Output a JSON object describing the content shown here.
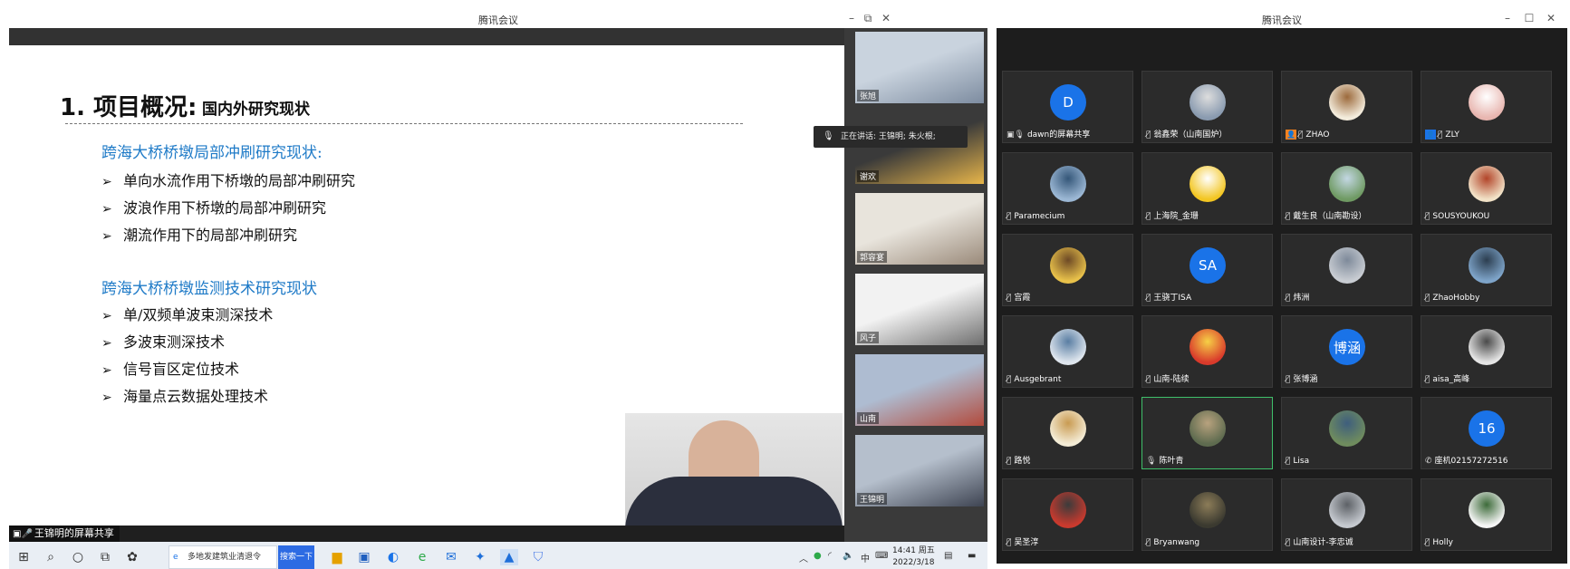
{
  "left_window": {
    "title": "腾讯会议",
    "controls": {
      "minimize": "–",
      "restore": "⧉",
      "close": "✕"
    },
    "slide": {
      "title": "1. 项目概况:",
      "subtitle": "国内外研究现状",
      "sections": [
        {
          "heading": "跨海大桥桥墩局部冲刷研究现状:",
          "items": [
            "单向水流作用下桥墩的局部冲刷研究",
            "波浪作用下桥墩的局部冲刷研究",
            "潮流作用下的局部冲刷研究"
          ]
        },
        {
          "heading": "跨海大桥桥墩监测技术研究现状",
          "items": [
            "单/双频单波束测深技术",
            "多波束测深技术",
            "信号盲区定位技术",
            "海量点云数据处理技术"
          ]
        }
      ],
      "bullet_glyph": "➢"
    },
    "share_label": "王锦明的屏幕共享",
    "speaking": "正在讲话: 王锦明; 朱火根;",
    "thumbnails": [
      {
        "name": "张旭",
        "colors": [
          "#c9d3de",
          "#7d8ca0"
        ]
      },
      {
        "name": "谢欢",
        "colors": [
          "#3a3a3a",
          "#e7b54a"
        ]
      },
      {
        "name": "郭容宴",
        "colors": [
          "#e8e4dc",
          "#9a8a7a"
        ]
      },
      {
        "name": "风子",
        "colors": [
          "#f2f2f2",
          "#6f6f6f"
        ]
      },
      {
        "name": "山南",
        "colors": [
          "#aebcd1",
          "#b24a3c"
        ]
      },
      {
        "name": "王锦明",
        "colors": [
          "#b5bfcc",
          "#3e4452"
        ]
      }
    ],
    "taskbar": {
      "search_text": "多地发建筑业清退令",
      "search_button": "搜索一下",
      "time": "14:41 周五",
      "date": "2022/3/18",
      "tray_text": [
        "中",
        "⌨"
      ]
    }
  },
  "right_window": {
    "title": "腾讯会议",
    "controls": {
      "minimize": "–",
      "restore": "☐",
      "close": "✕"
    },
    "participants": [
      {
        "name": "dawn的屏幕共享",
        "avatar": "D",
        "kind": "blue",
        "icon": "screen-mic"
      },
      {
        "name": "翁鑫荣（山南国炉）",
        "avatar": "",
        "colors": [
          "#8a9bb0",
          "#dddddd"
        ],
        "icon": "muted"
      },
      {
        "name": "ZHAO",
        "avatar": "",
        "colors": [
          "#f3ecdc",
          "#9c6a3c"
        ],
        "icon": "org-muted"
      },
      {
        "name": "ZLY",
        "avatar": "",
        "colors": [
          "#e8b6b0",
          "#ffffff"
        ],
        "icon": "blu-muted"
      },
      {
        "name": "Paramecium",
        "avatar": "",
        "colors": [
          "#9bb7d4",
          "#355779"
        ],
        "icon": "muted"
      },
      {
        "name": "上海院_金珊",
        "avatar": "",
        "colors": [
          "#f3c622",
          "#ffffff"
        ],
        "icon": "muted"
      },
      {
        "name": "戴生良（山南勘设）",
        "avatar": "",
        "colors": [
          "#6f9a63",
          "#c3d7e3"
        ],
        "icon": "muted"
      },
      {
        "name": "SOUSYOUKOU",
        "avatar": "",
        "colors": [
          "#f2e2c7",
          "#b2452a"
        ],
        "icon": "muted"
      },
      {
        "name": "宫霞",
        "avatar": "",
        "colors": [
          "#e8c14a",
          "#6e4a26"
        ],
        "icon": "muted"
      },
      {
        "name": "王骁丁ISA",
        "avatar": "SA",
        "kind": "blue",
        "icon": "muted"
      },
      {
        "name": "炜洲",
        "avatar": "",
        "colors": [
          "#c8ccd2",
          "#7e8a9a"
        ],
        "icon": "muted"
      },
      {
        "name": "ZhaoHobby",
        "avatar": "",
        "colors": [
          "#7ea4c9",
          "#2c3e50"
        ],
        "icon": "muted"
      },
      {
        "name": "Ausgebrant",
        "avatar": "",
        "colors": [
          "#dfe6ee",
          "#5a7ea3"
        ],
        "icon": "muted"
      },
      {
        "name": "山南-陆续",
        "avatar": "",
        "colors": [
          "#d93a2b",
          "#f6d046"
        ],
        "icon": "muted"
      },
      {
        "name": "张博涵",
        "avatar": "博涵",
        "kind": "blue",
        "icon": "muted"
      },
      {
        "name": "aisa_高峰",
        "avatar": "",
        "colors": [
          "#e5e5e5",
          "#4a4a4a"
        ],
        "icon": "muted"
      },
      {
        "name": "路悦",
        "avatar": "",
        "colors": [
          "#f4ecd6",
          "#c99b52"
        ],
        "icon": "muted"
      },
      {
        "name": "陈叶青",
        "avatar": "",
        "colors": [
          "#5e6b4f",
          "#b8a27e"
        ],
        "icon": "mic",
        "active": true
      },
      {
        "name": "Lisa",
        "avatar": "",
        "colors": [
          "#6f8c5e",
          "#3e5e7d"
        ],
        "icon": "muted"
      },
      {
        "name": "座机02157272516",
        "avatar": "16",
        "kind": "blue",
        "icon": "phone"
      },
      {
        "name": "吴圣淳",
        "avatar": "",
        "colors": [
          "#c93a2e",
          "#3b3b3b"
        ],
        "icon": "muted"
      },
      {
        "name": "Bryanwang",
        "avatar": "",
        "colors": [
          "#3b3a30",
          "#8c7c58"
        ],
        "icon": "muted"
      },
      {
        "name": "山南设计-李忠诚",
        "avatar": "",
        "colors": [
          "#c5c9cf",
          "#5d6166"
        ],
        "icon": "muted"
      },
      {
        "name": "Holly",
        "avatar": "",
        "colors": [
          "#f5f5f5",
          "#3d6b3a"
        ],
        "icon": "muted"
      }
    ]
  }
}
